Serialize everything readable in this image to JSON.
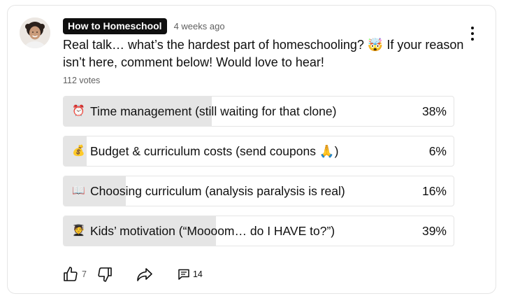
{
  "post": {
    "channel": "How to Homeschool",
    "time": "4 weeks ago",
    "text": "Real talk… what’s the hardest part of homeschooling? 🤯 If your reason isn’t here, comment below! Would love to hear!",
    "votes": "112 votes"
  },
  "poll": {
    "options": [
      {
        "emoji": "⏰",
        "label": "Time management (still waiting for that clone)",
        "percent_label": "38%",
        "percent": 38
      },
      {
        "emoji": "💰",
        "label": "Budget & curriculum costs (send coupons 🙏)",
        "percent_label": "6%",
        "percent": 6
      },
      {
        "emoji": "📖",
        "label": "Choosing curriculum (analysis paralysis is real)",
        "percent_label": "16%",
        "percent": 16
      },
      {
        "emoji": "🧑‍🎓",
        "label": "Kids’ motivation (“Moooom… do I HAVE to?”)",
        "percent_label": "39%",
        "percent": 39
      }
    ]
  },
  "actions": {
    "like_count": "7",
    "comment_count": "14",
    "icons": [
      "thumbs-up-icon",
      "thumbs-down-icon",
      "share-icon",
      "comment-icon",
      "more-vert-icon"
    ]
  },
  "colors": {
    "bar_fill": "#e5e5e5",
    "badge_bg": "#0f0f0f",
    "text": "#0f0f0f",
    "muted": "#606060"
  }
}
